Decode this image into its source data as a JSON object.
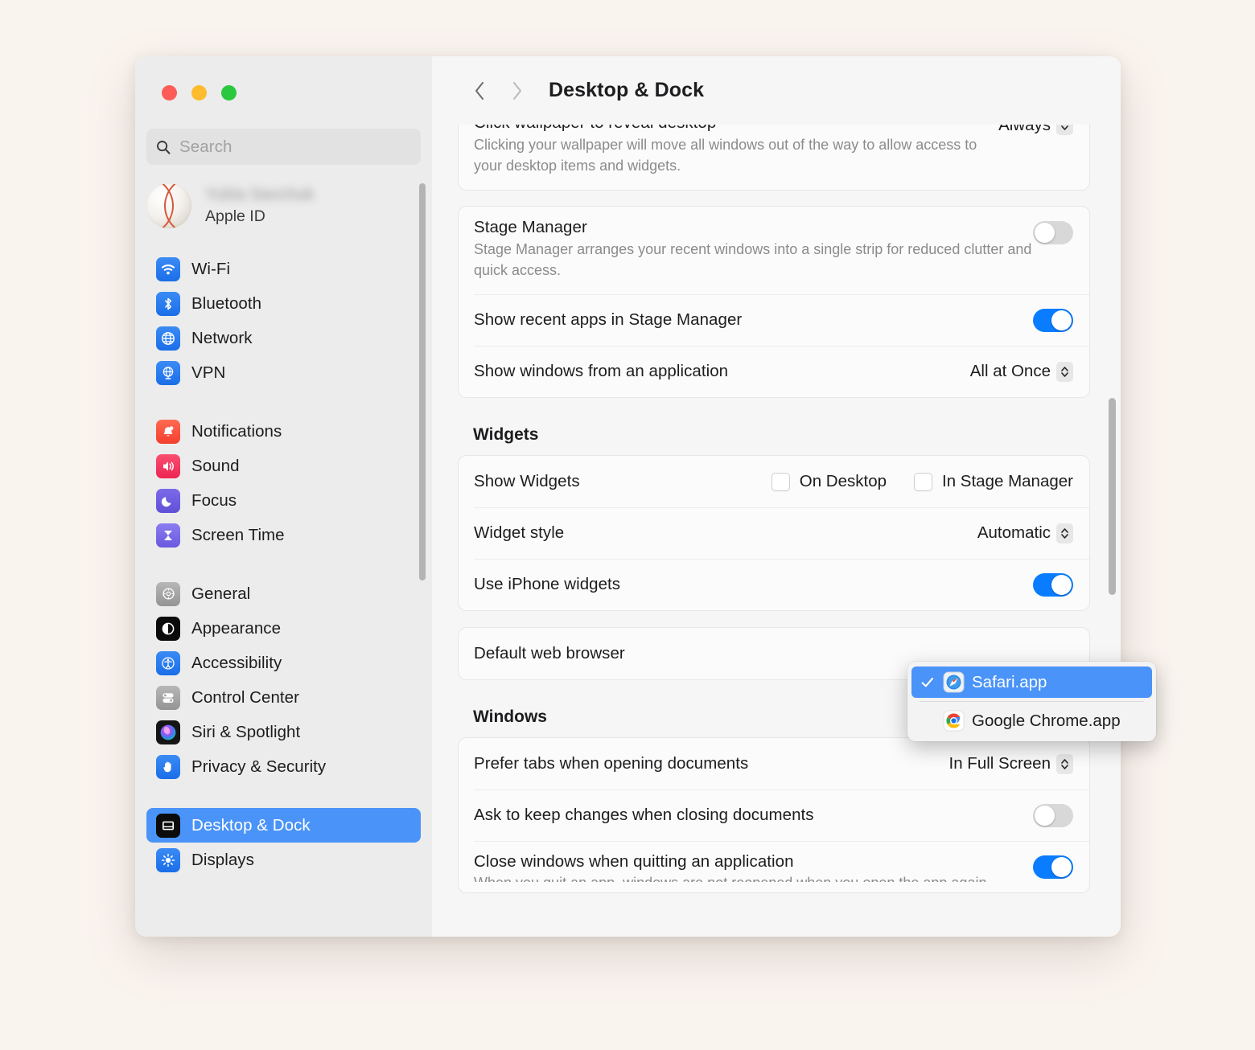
{
  "window": {
    "traffic_lights": [
      "close",
      "minimize",
      "zoom"
    ],
    "colors": {
      "accent_blue": "#0a7cff",
      "selection_blue": "#4a93f8",
      "desktop_bg": "#faf4ef",
      "sidebar_bg": "#ececec",
      "content_bg": "#f6f6f6"
    }
  },
  "sidebar": {
    "search": {
      "placeholder": "Search",
      "value": ""
    },
    "account": {
      "name": "",
      "subtitle": "Apple ID"
    },
    "groups": [
      {
        "items": [
          {
            "label": "Wi-Fi",
            "icon": "wifi-icon"
          },
          {
            "label": "Bluetooth",
            "icon": "bluetooth-icon"
          },
          {
            "label": "Network",
            "icon": "network-globe-icon"
          },
          {
            "label": "VPN",
            "icon": "vpn-globe-icon"
          }
        ]
      },
      {
        "items": [
          {
            "label": "Notifications",
            "icon": "bell-icon"
          },
          {
            "label": "Sound",
            "icon": "speaker-icon"
          },
          {
            "label": "Focus",
            "icon": "moon-icon"
          },
          {
            "label": "Screen Time",
            "icon": "hourglass-icon"
          }
        ]
      },
      {
        "items": [
          {
            "label": "General",
            "icon": "gear-icon"
          },
          {
            "label": "Appearance",
            "icon": "appearance-icon"
          },
          {
            "label": "Accessibility",
            "icon": "accessibility-icon"
          },
          {
            "label": "Control Center",
            "icon": "control-center-icon"
          },
          {
            "label": "Siri & Spotlight",
            "icon": "siri-icon"
          },
          {
            "label": "Privacy & Security",
            "icon": "hand-icon"
          }
        ]
      },
      {
        "items": [
          {
            "label": "Desktop & Dock",
            "icon": "desktop-dock-icon",
            "selected": true
          },
          {
            "label": "Displays",
            "icon": "displays-icon"
          }
        ]
      }
    ]
  },
  "toolbar": {
    "back_icon": "chevron-left-icon",
    "forward_icon": "chevron-right-icon",
    "title": "Desktop & Dock"
  },
  "main": {
    "click_wallpaper": {
      "label": "Click wallpaper to reveal desktop",
      "value": "Always",
      "description": "Clicking your wallpaper will move all windows out of the way to allow access to your desktop items and widgets."
    },
    "stage_manager": {
      "label": "Stage Manager",
      "description": "Stage Manager arranges your recent windows into a single strip for reduced clutter and quick access.",
      "enabled": false
    },
    "show_recent_apps": {
      "label": "Show recent apps in Stage Manager",
      "enabled": true
    },
    "show_windows_from_app": {
      "label": "Show windows from an application",
      "value": "All at Once"
    },
    "widgets_section_title": "Widgets",
    "show_widgets": {
      "label": "Show Widgets",
      "options": [
        {
          "label": "On Desktop",
          "checked": false
        },
        {
          "label": "In Stage Manager",
          "checked": false
        }
      ]
    },
    "widget_style": {
      "label": "Widget style",
      "value": "Automatic"
    },
    "use_iphone_widgets": {
      "label": "Use iPhone widgets",
      "enabled": true
    },
    "default_web_browser": {
      "label": "Default web browser"
    },
    "windows_section_title": "Windows",
    "prefer_tabs": {
      "label": "Prefer tabs when opening documents",
      "value": "In Full Screen"
    },
    "ask_to_keep_changes": {
      "label": "Ask to keep changes when closing documents",
      "enabled": false
    },
    "close_windows_quitting": {
      "label": "Close windows when quitting an application",
      "enabled": true
    }
  },
  "browser_menu": {
    "items": [
      {
        "label": "Safari.app",
        "icon": "safari-icon",
        "checked": true
      },
      {
        "label": "Google Chrome.app",
        "icon": "chrome-icon",
        "checked": false
      }
    ]
  }
}
